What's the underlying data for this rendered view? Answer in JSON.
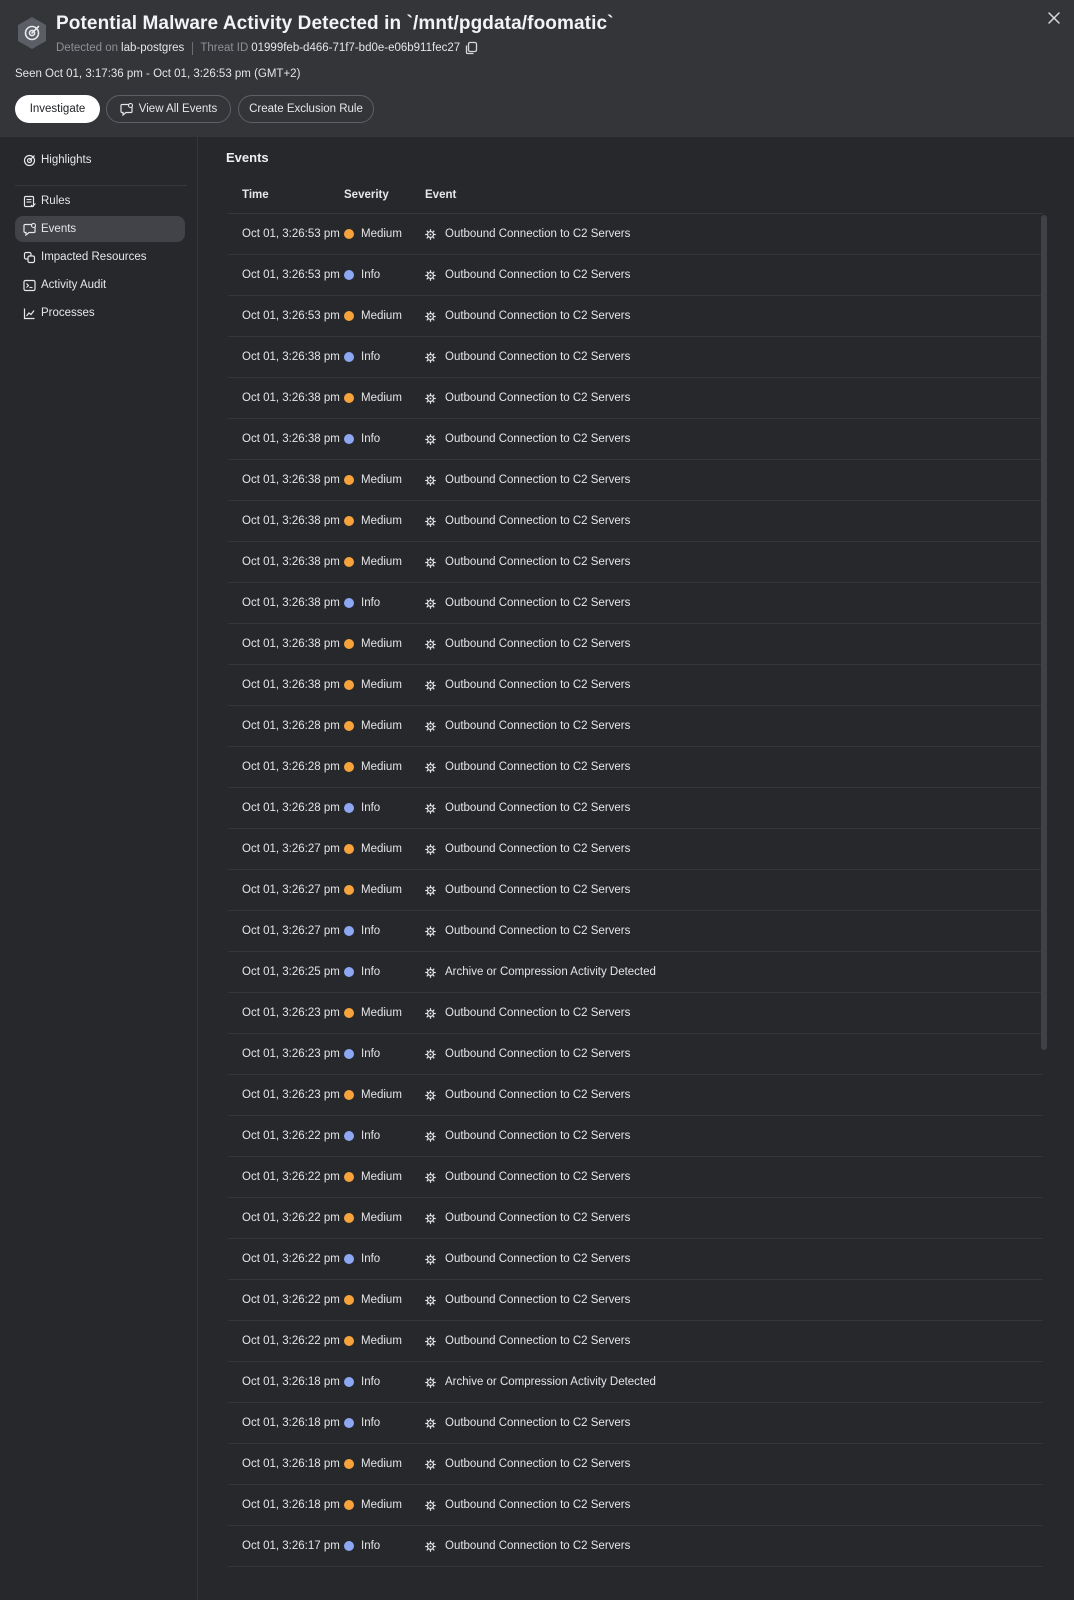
{
  "header": {
    "title": "Potential Malware Activity Detected in `/mnt/pgdata/foomatic`",
    "detected_label": "Detected on",
    "detected_value": "lab-postgres",
    "threat_label": "Threat ID",
    "threat_value": "01999feb-d466-71f7-bd0e-e06b911fec27",
    "seen": "Seen Oct 01, 3:17:36 pm - Oct 01, 3:26:53 pm (GMT+2)"
  },
  "actions": {
    "investigate": "Investigate",
    "view_all_events": "View All Events",
    "create_exclusion_rule": "Create Exclusion Rule"
  },
  "sidebar": {
    "items": [
      {
        "label": "Highlights",
        "icon": "highlights-icon"
      },
      {
        "label": "Rules",
        "icon": "rules-icon"
      },
      {
        "label": "Events",
        "icon": "events-icon",
        "active": true
      },
      {
        "label": "Impacted Resources",
        "icon": "resources-icon"
      },
      {
        "label": "Activity Audit",
        "icon": "terminal-icon"
      },
      {
        "label": "Processes",
        "icon": "chart-line-icon"
      }
    ]
  },
  "main": {
    "title": "Events",
    "columns": {
      "time": "Time",
      "severity": "Severity",
      "event": "Event"
    }
  },
  "colors": {
    "medium": "#f6a33c",
    "info": "#8ea7f3"
  },
  "events": [
    {
      "time": "Oct 01, 3:26:53 pm",
      "severity": "Medium",
      "event": "Outbound Connection to C2 Servers"
    },
    {
      "time": "Oct 01, 3:26:53 pm",
      "severity": "Info",
      "event": "Outbound Connection to C2 Servers"
    },
    {
      "time": "Oct 01, 3:26:53 pm",
      "severity": "Medium",
      "event": "Outbound Connection to C2 Servers"
    },
    {
      "time": "Oct 01, 3:26:38 pm",
      "severity": "Info",
      "event": "Outbound Connection to C2 Servers"
    },
    {
      "time": "Oct 01, 3:26:38 pm",
      "severity": "Medium",
      "event": "Outbound Connection to C2 Servers"
    },
    {
      "time": "Oct 01, 3:26:38 pm",
      "severity": "Info",
      "event": "Outbound Connection to C2 Servers"
    },
    {
      "time": "Oct 01, 3:26:38 pm",
      "severity": "Medium",
      "event": "Outbound Connection to C2 Servers"
    },
    {
      "time": "Oct 01, 3:26:38 pm",
      "severity": "Medium",
      "event": "Outbound Connection to C2 Servers"
    },
    {
      "time": "Oct 01, 3:26:38 pm",
      "severity": "Medium",
      "event": "Outbound Connection to C2 Servers"
    },
    {
      "time": "Oct 01, 3:26:38 pm",
      "severity": "Info",
      "event": "Outbound Connection to C2 Servers"
    },
    {
      "time": "Oct 01, 3:26:38 pm",
      "severity": "Medium",
      "event": "Outbound Connection to C2 Servers"
    },
    {
      "time": "Oct 01, 3:26:38 pm",
      "severity": "Medium",
      "event": "Outbound Connection to C2 Servers"
    },
    {
      "time": "Oct 01, 3:26:28 pm",
      "severity": "Medium",
      "event": "Outbound Connection to C2 Servers"
    },
    {
      "time": "Oct 01, 3:26:28 pm",
      "severity": "Medium",
      "event": "Outbound Connection to C2 Servers"
    },
    {
      "time": "Oct 01, 3:26:28 pm",
      "severity": "Info",
      "event": "Outbound Connection to C2 Servers"
    },
    {
      "time": "Oct 01, 3:26:27 pm",
      "severity": "Medium",
      "event": "Outbound Connection to C2 Servers"
    },
    {
      "time": "Oct 01, 3:26:27 pm",
      "severity": "Medium",
      "event": "Outbound Connection to C2 Servers"
    },
    {
      "time": "Oct 01, 3:26:27 pm",
      "severity": "Info",
      "event": "Outbound Connection to C2 Servers"
    },
    {
      "time": "Oct 01, 3:26:25 pm",
      "severity": "Info",
      "event": "Archive or Compression Activity Detected"
    },
    {
      "time": "Oct 01, 3:26:23 pm",
      "severity": "Medium",
      "event": "Outbound Connection to C2 Servers"
    },
    {
      "time": "Oct 01, 3:26:23 pm",
      "severity": "Info",
      "event": "Outbound Connection to C2 Servers"
    },
    {
      "time": "Oct 01, 3:26:23 pm",
      "severity": "Medium",
      "event": "Outbound Connection to C2 Servers"
    },
    {
      "time": "Oct 01, 3:26:22 pm",
      "severity": "Info",
      "event": "Outbound Connection to C2 Servers"
    },
    {
      "time": "Oct 01, 3:26:22 pm",
      "severity": "Medium",
      "event": "Outbound Connection to C2 Servers"
    },
    {
      "time": "Oct 01, 3:26:22 pm",
      "severity": "Medium",
      "event": "Outbound Connection to C2 Servers"
    },
    {
      "time": "Oct 01, 3:26:22 pm",
      "severity": "Info",
      "event": "Outbound Connection to C2 Servers"
    },
    {
      "time": "Oct 01, 3:26:22 pm",
      "severity": "Medium",
      "event": "Outbound Connection to C2 Servers"
    },
    {
      "time": "Oct 01, 3:26:22 pm",
      "severity": "Medium",
      "event": "Outbound Connection to C2 Servers"
    },
    {
      "time": "Oct 01, 3:26:18 pm",
      "severity": "Info",
      "event": "Archive or Compression Activity Detected"
    },
    {
      "time": "Oct 01, 3:26:18 pm",
      "severity": "Info",
      "event": "Outbound Connection to C2 Servers"
    },
    {
      "time": "Oct 01, 3:26:18 pm",
      "severity": "Medium",
      "event": "Outbound Connection to C2 Servers"
    },
    {
      "time": "Oct 01, 3:26:18 pm",
      "severity": "Medium",
      "event": "Outbound Connection to C2 Servers"
    },
    {
      "time": "Oct 01, 3:26:17 pm",
      "severity": "Info",
      "event": "Outbound Connection to C2 Servers"
    }
  ]
}
